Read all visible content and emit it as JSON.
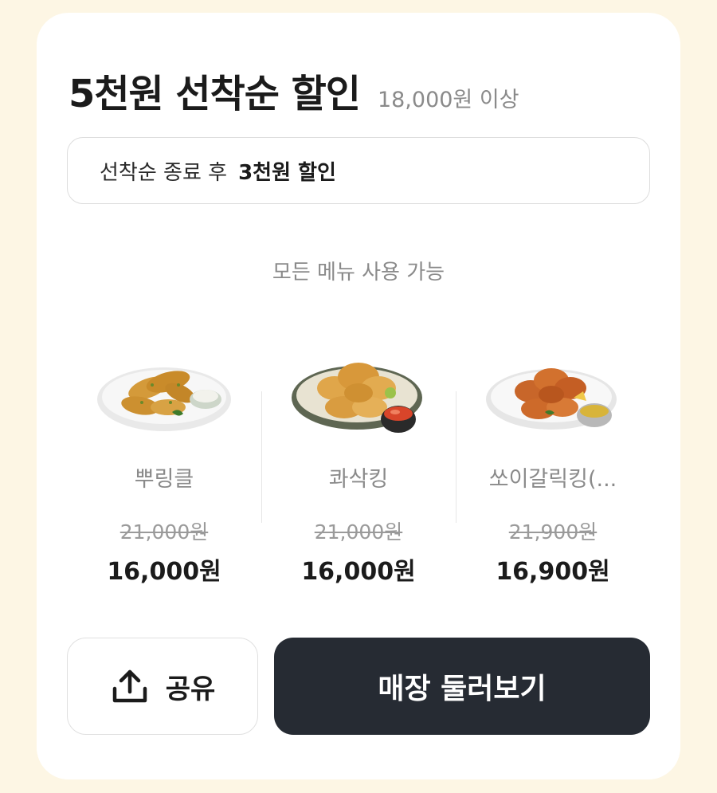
{
  "coupon": {
    "title": "5천원 선착순 할인",
    "condition": "18,000원 이상",
    "after_prefix": "선착순 종료 후",
    "after_value": "3천원 할인",
    "menu_note": "모든 메뉴 사용 가능"
  },
  "products": [
    {
      "name": "뿌링클",
      "original_price": "21,000원",
      "sale_price": "16,000원"
    },
    {
      "name": "콰삭킹",
      "original_price": "21,000원",
      "sale_price": "16,000원"
    },
    {
      "name": "쏘이갈릭킹(...",
      "original_price": "21,900원",
      "sale_price": "16,900원"
    }
  ],
  "actions": {
    "share_label": "공유",
    "share_icon": "share-upload-icon",
    "store_label": "매장 둘러보기"
  },
  "colors": {
    "background": "#fdf6e4",
    "card": "#ffffff",
    "primary_button": "#262b33",
    "muted_text": "#8a8a8a"
  }
}
